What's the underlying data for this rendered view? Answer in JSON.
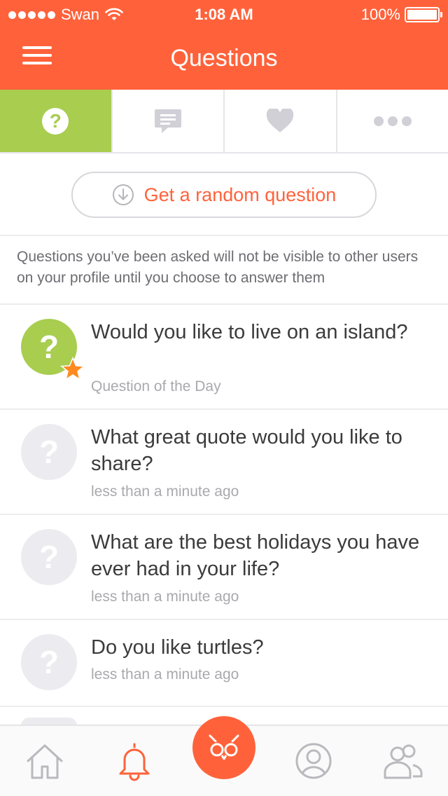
{
  "status_bar": {
    "carrier": "Swan",
    "time": "1:08 AM",
    "battery": "100%"
  },
  "header": {
    "title": "Questions",
    "menu_icon": "hamburger-icon"
  },
  "tabs": [
    {
      "icon": "question-icon",
      "active": true
    },
    {
      "icon": "chat-bubble-icon",
      "active": false
    },
    {
      "icon": "heart-icon",
      "active": false
    },
    {
      "icon": "more-dots-icon",
      "active": false
    }
  ],
  "random_button": {
    "label": "Get a random question",
    "icon": "download-circle-icon"
  },
  "info_text": "Questions you’ve been asked will not be visible to other users on your profile until you choose to answer them",
  "questions": [
    {
      "text": "Would you like to live on an island?",
      "meta": "Question of the Day",
      "featured": true
    },
    {
      "text": "What great quote would you like to share?",
      "meta": "less than a minute ago",
      "featured": false
    },
    {
      "text": "What are the best holidays you have ever had in your life?",
      "meta": "less than a minute ago",
      "featured": false
    },
    {
      "text": "Do you like turtles?",
      "meta": "less than a minute ago",
      "featured": false
    }
  ],
  "tabbar": [
    {
      "icon": "home-icon"
    },
    {
      "icon": "bell-icon",
      "active": true
    },
    {
      "icon": "owl-icon"
    },
    {
      "icon": "profile-icon"
    },
    {
      "icon": "people-icon"
    }
  ],
  "colors": {
    "brand_orange": "#ff623b",
    "active_green": "#a8cd4f",
    "muted_grey": "#a9a9ae",
    "icon_grey": "#d0d0d6"
  }
}
